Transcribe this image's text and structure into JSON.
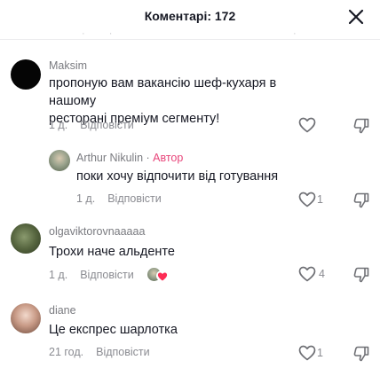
{
  "header": {
    "title": "Коментарі: 172"
  },
  "comments": [
    {
      "username": "Maksim",
      "text_line1": "пропоную вам вакансію шеф-кухаря в нашому",
      "text_line2": "ресторані преміум сегменту!",
      "time": "1 д.",
      "reply_label": "Відповісти",
      "likes": ""
    },
    {
      "username": "Arthur Nikulin",
      "author_label": "Автор",
      "text_line1": "поки хочу відпочити від готування",
      "time": "1 д.",
      "reply_label": "Відповісти",
      "likes": "1"
    },
    {
      "username": "olgaviktorovnaaaaa",
      "text_line1": "Трохи наче альденте",
      "time": "1 д.",
      "reply_label": "Відповісти",
      "likes": "4"
    },
    {
      "username": "diane",
      "text_line1": "Це експрес шарлотка",
      "time": "21 год.",
      "reply_label": "Відповісти",
      "likes": "1"
    }
  ],
  "colors": {
    "author_tag": "#e8457a",
    "creator_like_heart": "#fe2c55",
    "muted_text": "#8a8b91"
  },
  "icons": {
    "close": "close-icon",
    "like": "heart-outline-icon",
    "dislike": "thumbs-down-icon",
    "creator_liked": "creator-liked-icon"
  }
}
